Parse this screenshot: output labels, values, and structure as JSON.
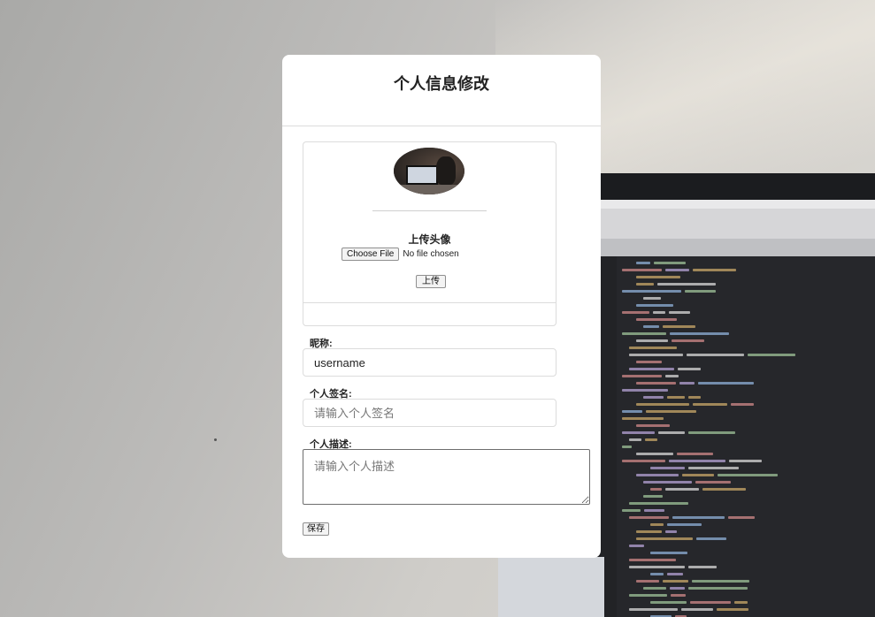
{
  "form": {
    "title": "个人信息修改",
    "avatar": {
      "upload_title": "上传头像",
      "choose_file_label": "Choose File",
      "file_status": "No file chosen",
      "upload_label": "上传"
    },
    "nickname": {
      "label": "昵称:",
      "value": "username"
    },
    "signature": {
      "label": "个人签名:",
      "value": "",
      "placeholder": "请输入个人签名"
    },
    "description": {
      "label": "个人描述:",
      "value": "",
      "placeholder": "请输入个人描述"
    },
    "save_label": "保存"
  }
}
